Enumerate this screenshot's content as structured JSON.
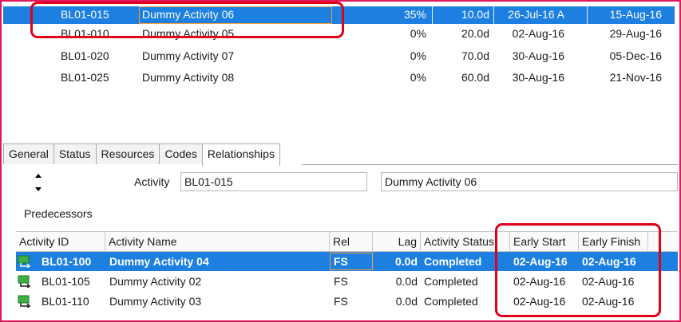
{
  "activities": [
    {
      "id": "BL01-015",
      "name": "Dummy Activity 06",
      "pct": "35%",
      "dur": "10.0d",
      "start": "26-Jul-16 A",
      "finish": "15-Aug-16",
      "selected": true
    },
    {
      "id": "BL01-010",
      "name": "Dummy Activity 05",
      "pct": "0%",
      "dur": "20.0d",
      "start": "02-Aug-16",
      "finish": "29-Aug-16"
    },
    {
      "id": "BL01-020",
      "name": "Dummy Activity 07",
      "pct": "0%",
      "dur": "70.0d",
      "start": "30-Aug-16",
      "finish": "05-Dec-16"
    },
    {
      "id": "BL01-025",
      "name": "Dummy Activity 08",
      "pct": "0%",
      "dur": "60.0d",
      "start": "30-Aug-16",
      "finish": "21-Nov-16"
    }
  ],
  "tabs": [
    "General",
    "Status",
    "Resources",
    "Codes",
    "Relationships"
  ],
  "detail": {
    "activity_label": "Activity",
    "activity_id": "BL01-015",
    "activity_name": "Dummy Activity 06",
    "predecessors_label": "Predecessors"
  },
  "pred_columns": [
    "Activity ID",
    "Activity Name",
    "Rel",
    "Lag",
    "Activity Status",
    "Early Start",
    "Early Finish"
  ],
  "predecessors": [
    {
      "id": "BL01-100",
      "name": "Dummy Activity 04",
      "rel": "FS",
      "lag": "0.0d",
      "status": "Completed",
      "es": "02-Aug-16",
      "ef": "02-Aug-16",
      "selected": true
    },
    {
      "id": "BL01-105",
      "name": "Dummy Activity 02",
      "rel": "FS",
      "lag": "0.0d",
      "status": "Completed",
      "es": "02-Aug-16",
      "ef": "02-Aug-16"
    },
    {
      "id": "BL01-110",
      "name": "Dummy Activity 03",
      "rel": "FS",
      "lag": "0.0d",
      "status": "Completed",
      "es": "02-Aug-16",
      "ef": "02-Aug-16"
    }
  ],
  "colors": {
    "selection": "#1d7fe0",
    "highlight": "#e0001a",
    "frame": "#e0175a",
    "icon": "#3cb043"
  }
}
